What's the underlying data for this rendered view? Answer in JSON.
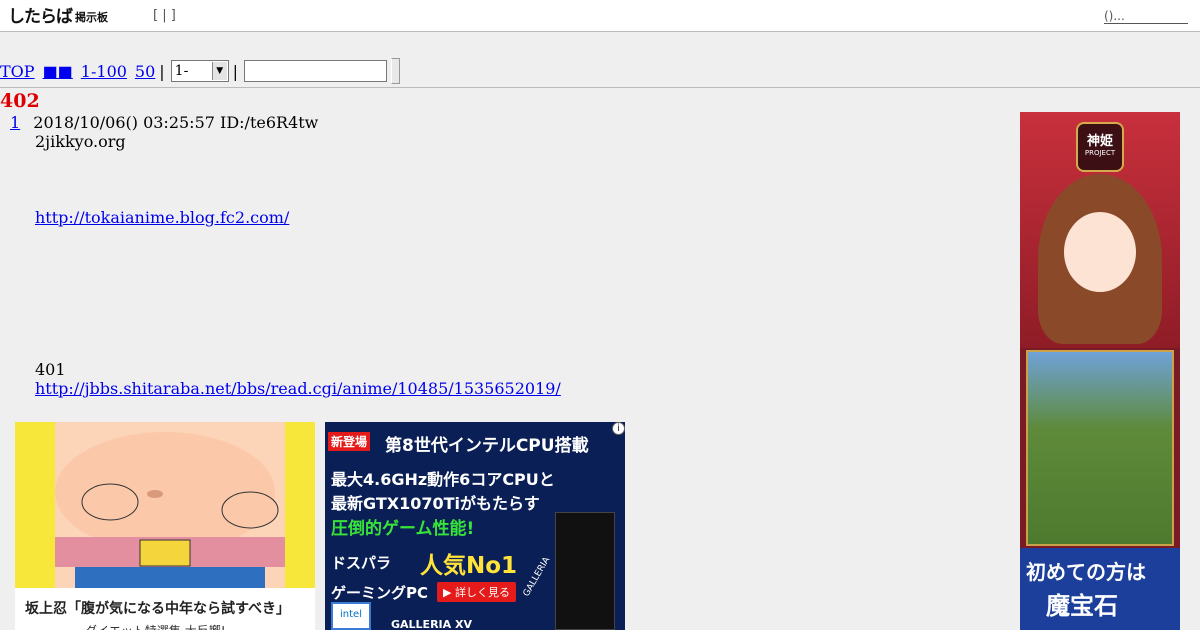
{
  "header": {
    "logo_main": "したらば",
    "logo_sub": "掲示板",
    "brackets": "[ | ]",
    "right_link": "()..."
  },
  "nav": {
    "top": "TOP",
    "squares": "■■",
    "range": "1-100",
    "last": "50",
    "sep": "|",
    "select_value": "1-"
  },
  "thread": {
    "title": "402",
    "post_num": "1",
    "post_meta": "2018/10/06() 03:25:57 ID:/te6R4tw",
    "line1": "2jikkyo.org",
    "link1": "http://tokaianime.blog.fc2.com/",
    "line_num": "401",
    "link2": "http://jbbs.shitaraba.net/bbs/read.cgi/anime/10485/1535652019/"
  },
  "ads": {
    "ad1_caption": "坂上忍「腹が気になる中年なら試すべき」",
    "ad1_caption2": "ダイエット特選集 大反響!",
    "ad2_info": "i",
    "ad2_tag": "新登場",
    "ad2_headline": "第8世代インテルCPU搭載",
    "ad2_line1": "最大4.6GHz動作6コアCPUと",
    "ad2_line2": "最新GTX1070Tiがもたらす",
    "ad2_line3": "圧倒的ゲーム性能!",
    "ad2_line4a": "ドスパラ",
    "ad2_line4b": "人気No1",
    "ad2_line5": "ゲーミングPC",
    "ad2_more": "▶ 詳しく見る",
    "ad2_pc": "GALLERIA",
    "ad2_intel": "intel",
    "ad2_model": "GALLERIA XV",
    "side_logo": "神姫",
    "side_logo_sub": "PROJECT",
    "side_t1": "初めての方は",
    "side_t2": "魔宝石"
  }
}
